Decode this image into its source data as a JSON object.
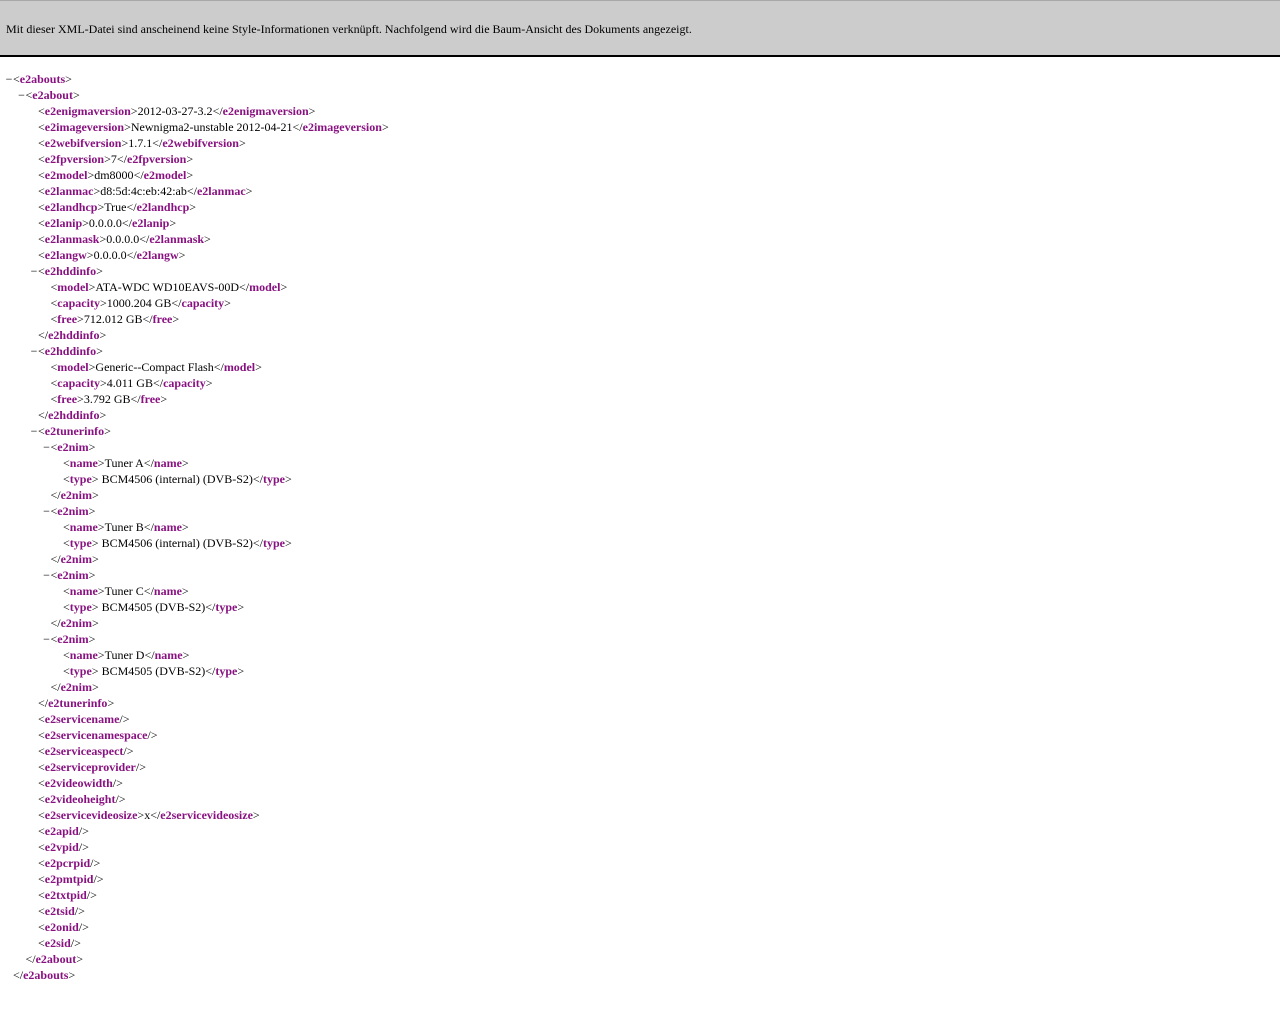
{
  "banner": {
    "message": "Mit dieser XML-Datei sind anscheinend keine Style-Informationen verknüpft. Nachfolgend wird die Baum-Ansicht des Dokuments angezeigt."
  },
  "toggle_symbol": "−",
  "xml": {
    "tag": "e2abouts",
    "children": [
      {
        "tag": "e2about",
        "children": [
          {
            "tag": "e2enigmaversion",
            "text": "2012-03-27-3.2"
          },
          {
            "tag": "e2imageversion",
            "text": "Newnigma2-unstable 2012-04-21"
          },
          {
            "tag": "e2webifversion",
            "text": "1.7.1"
          },
          {
            "tag": "e2fpversion",
            "text": "7"
          },
          {
            "tag": "e2model",
            "text": "dm8000"
          },
          {
            "tag": "e2lanmac",
            "text": "d8:5d:4c:eb:42:ab"
          },
          {
            "tag": "e2landhcp",
            "text": "True"
          },
          {
            "tag": "e2lanip",
            "text": "0.0.0.0"
          },
          {
            "tag": "e2lanmask",
            "text": "0.0.0.0"
          },
          {
            "tag": "e2langw",
            "text": "0.0.0.0"
          },
          {
            "tag": "e2hddinfo",
            "children": [
              {
                "tag": "model",
                "text": "ATA-WDC WD10EAVS-00D"
              },
              {
                "tag": "capacity",
                "text": "1000.204 GB"
              },
              {
                "tag": "free",
                "text": "712.012 GB"
              }
            ]
          },
          {
            "tag": "e2hddinfo",
            "children": [
              {
                "tag": "model",
                "text": "Generic--Compact Flash"
              },
              {
                "tag": "capacity",
                "text": "4.011 GB"
              },
              {
                "tag": "free",
                "text": "3.792 GB"
              }
            ]
          },
          {
            "tag": "e2tunerinfo",
            "children": [
              {
                "tag": "e2nim",
                "children": [
                  {
                    "tag": "name",
                    "text": "Tuner A"
                  },
                  {
                    "tag": "type",
                    "text": " BCM4506 (internal) (DVB-S2)"
                  }
                ]
              },
              {
                "tag": "e2nim",
                "children": [
                  {
                    "tag": "name",
                    "text": "Tuner B"
                  },
                  {
                    "tag": "type",
                    "text": " BCM4506 (internal) (DVB-S2)"
                  }
                ]
              },
              {
                "tag": "e2nim",
                "children": [
                  {
                    "tag": "name",
                    "text": "Tuner C"
                  },
                  {
                    "tag": "type",
                    "text": " BCM4505 (DVB-S2)"
                  }
                ]
              },
              {
                "tag": "e2nim",
                "children": [
                  {
                    "tag": "name",
                    "text": "Tuner D"
                  },
                  {
                    "tag": "type",
                    "text": " BCM4505 (DVB-S2)"
                  }
                ]
              }
            ]
          },
          {
            "tag": "e2servicename"
          },
          {
            "tag": "e2servicenamespace"
          },
          {
            "tag": "e2serviceaspect"
          },
          {
            "tag": "e2serviceprovider"
          },
          {
            "tag": "e2videowidth"
          },
          {
            "tag": "e2videoheight"
          },
          {
            "tag": "e2servicevideosize",
            "text": "x"
          },
          {
            "tag": "e2apid"
          },
          {
            "tag": "e2vpid"
          },
          {
            "tag": "e2pcrpid"
          },
          {
            "tag": "e2pmtpid"
          },
          {
            "tag": "e2txtpid"
          },
          {
            "tag": "e2tsid"
          },
          {
            "tag": "e2onid"
          },
          {
            "tag": "e2sid"
          }
        ]
      }
    ]
  }
}
